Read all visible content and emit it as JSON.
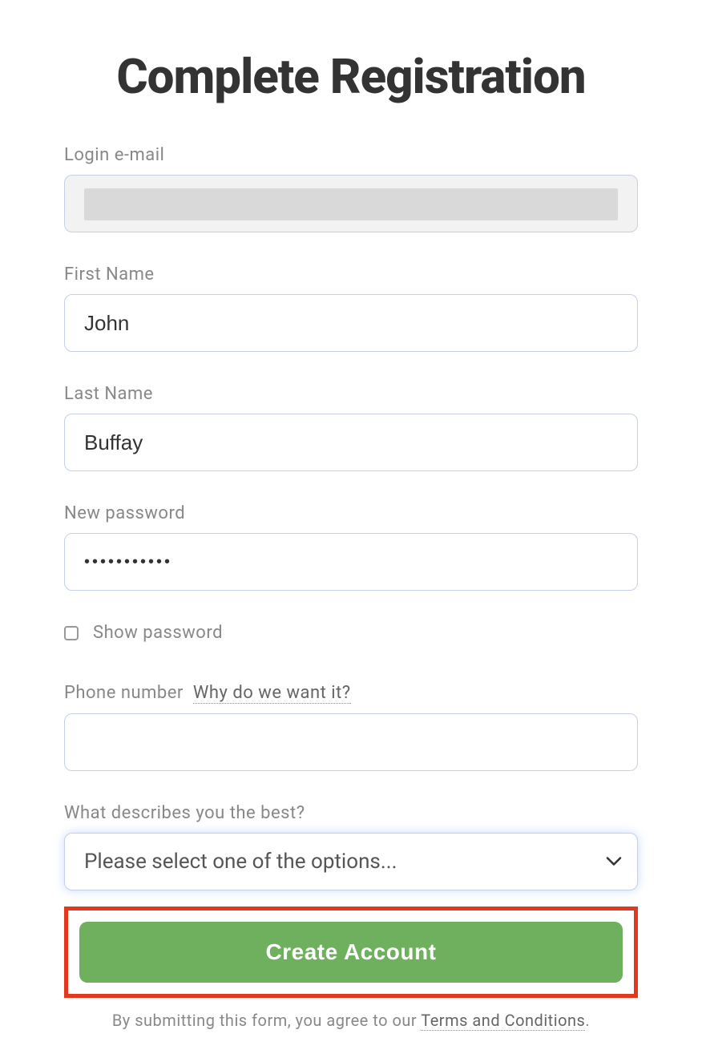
{
  "title": "Complete Registration",
  "fields": {
    "email": {
      "label": "Login e-mail",
      "value": ""
    },
    "first_name": {
      "label": "First Name",
      "value": "John"
    },
    "last_name": {
      "label": "Last Name",
      "value": "Buffay"
    },
    "password": {
      "label": "New password",
      "value": "•••••••••••"
    },
    "show_password": {
      "label": "Show password",
      "checked": false
    },
    "phone": {
      "label": "Phone number",
      "why_link": "Why do we want it?",
      "value": ""
    },
    "describe": {
      "label": "What describes you the best?",
      "placeholder": "Please select one of the options..."
    }
  },
  "submit_label": "Create Account",
  "footer": {
    "prefix": "By submitting this form, you agree to our ",
    "terms_link": "Terms and Conditions",
    "suffix": "."
  }
}
